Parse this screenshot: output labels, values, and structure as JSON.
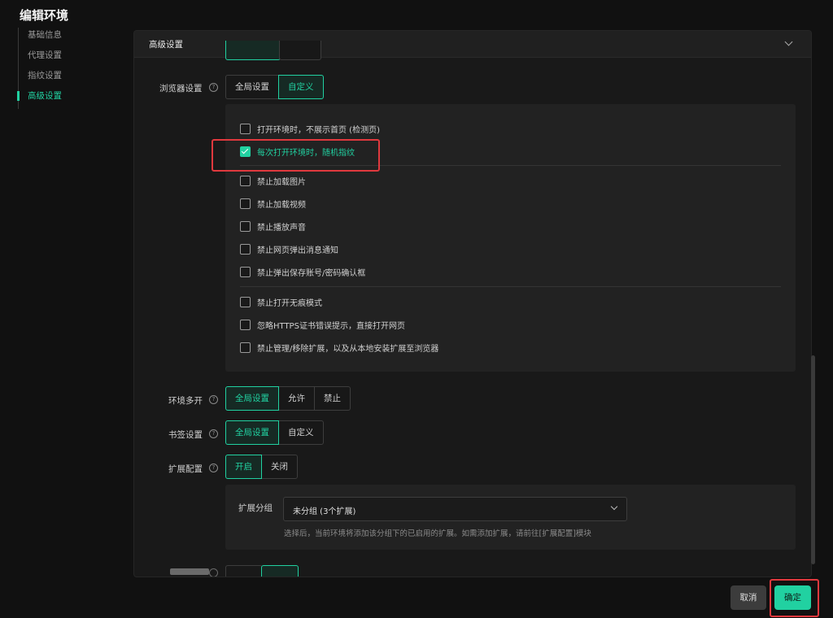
{
  "page": {
    "title": "编辑环境"
  },
  "nav": {
    "items": [
      {
        "label": "基础信息"
      },
      {
        "label": "代理设置"
      },
      {
        "label": "指纹设置"
      },
      {
        "label": "高级设置"
      }
    ]
  },
  "panel": {
    "title": "高级设置"
  },
  "browser": {
    "label": "浏览器设置",
    "help": "?",
    "options": [
      "全局设置",
      "自定义"
    ],
    "selected": "自定义",
    "checkboxes": [
      {
        "label": "打开环境时，不展示首页 (检测页)",
        "checked": false
      },
      {
        "label": "每次打开环境时，随机指纹",
        "checked": true
      },
      {
        "label": "禁止加载图片",
        "checked": false
      },
      {
        "label": "禁止加载视频",
        "checked": false
      },
      {
        "label": "禁止播放声音",
        "checked": false
      },
      {
        "label": "禁止网页弹出消息通知",
        "checked": false
      },
      {
        "label": "禁止弹出保存账号/密码确认框",
        "checked": false
      },
      {
        "label": "禁止打开无痕模式",
        "checked": false
      },
      {
        "label": "忽略HTTPS证书错误提示，直接打开网页",
        "checked": false
      },
      {
        "label": "禁止管理/移除扩展，以及从本地安装扩展至浏览器",
        "checked": false
      }
    ]
  },
  "multi": {
    "label": "环境多开",
    "help": "?",
    "options": [
      "全局设置",
      "允许",
      "禁止"
    ],
    "selected": "全局设置"
  },
  "bookmark": {
    "label": "书签设置",
    "help": "?",
    "options": [
      "全局设置",
      "自定义"
    ],
    "selected": "全局设置"
  },
  "extension": {
    "label": "扩展配置",
    "help": "?",
    "options": [
      "开启",
      "关闭"
    ],
    "selected": "开启",
    "group_label": "扩展分组",
    "group_value": "未分组 (3个扩展)",
    "hint": "选择后，当前环境将添加该分组下的已启用的扩展。如需添加扩展，请前往[扩展配置]模块"
  },
  "footer": {
    "cancel": "取消",
    "ok": "确定"
  },
  "colors": {
    "accent": "#21d1a1",
    "highlight": "#e0393e",
    "background": "#111111"
  }
}
